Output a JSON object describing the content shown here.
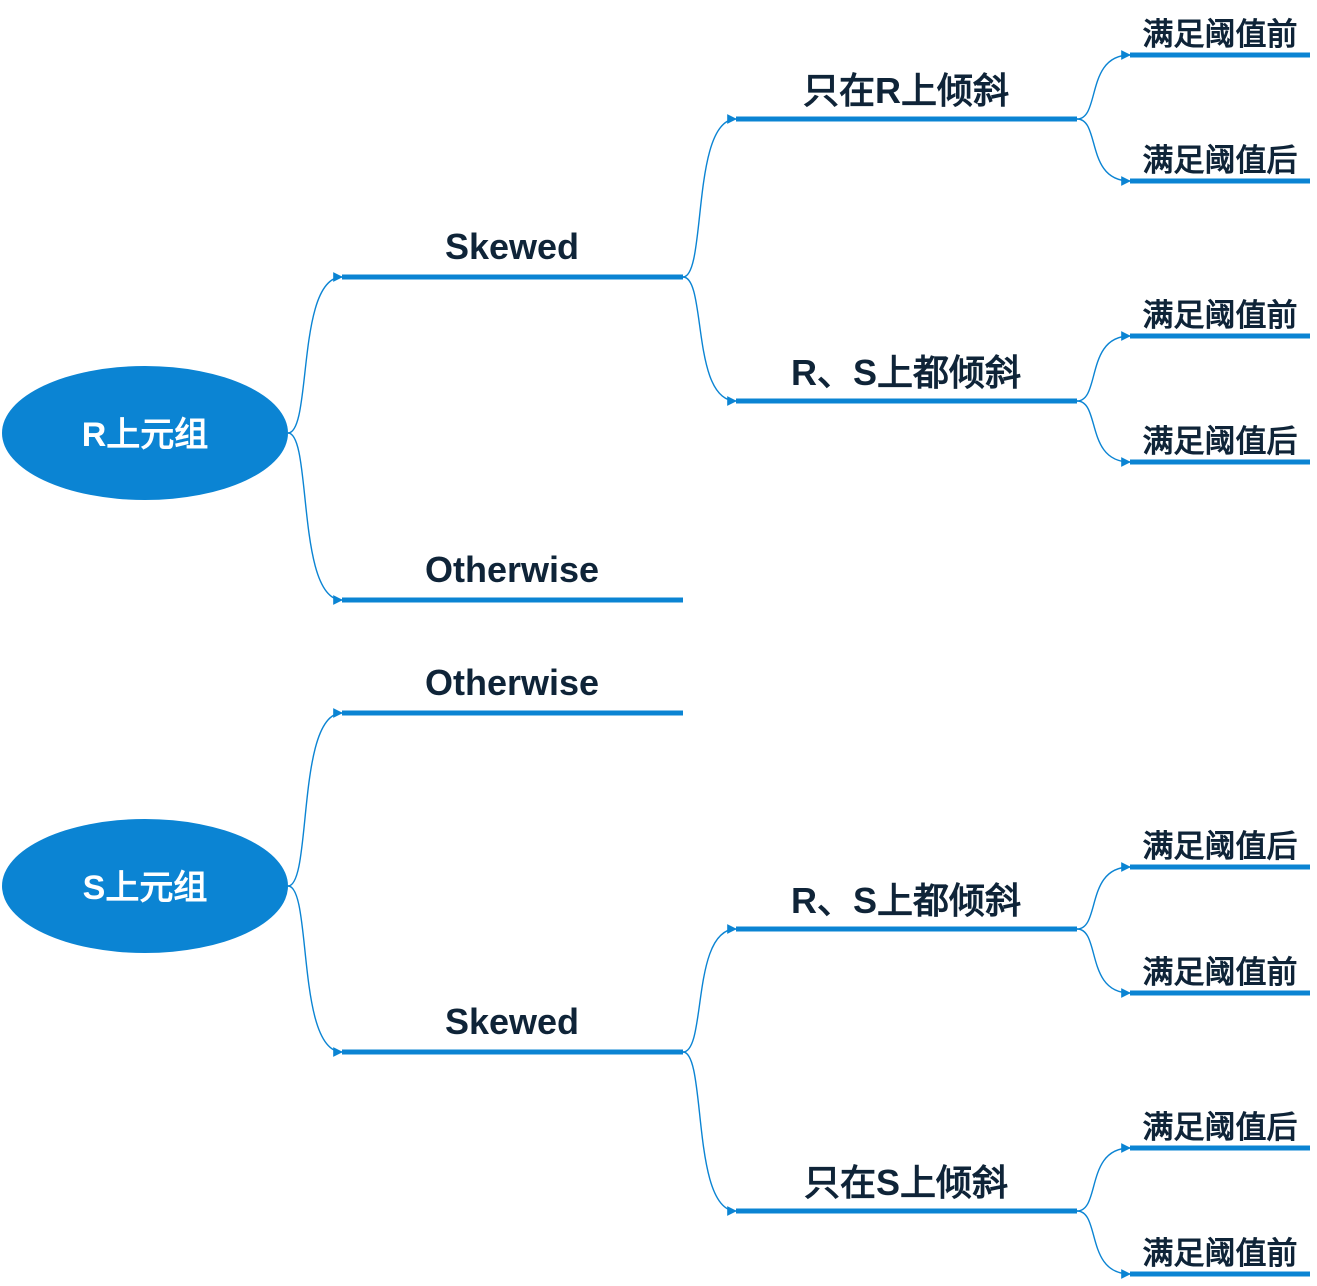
{
  "colors": {
    "accent": "#0b84d3",
    "text": "#0f2438",
    "root_text": "#ffffff"
  },
  "trees": [
    {
      "root": "R上元组",
      "branches": [
        {
          "label": "Skewed",
          "children": [
            {
              "label": "只在R上倾斜",
              "leaves": [
                "满足阈值前",
                "满足阈值后"
              ]
            },
            {
              "label": "R、S上都倾斜",
              "leaves": [
                "满足阈值前",
                "满足阈值后"
              ]
            }
          ]
        },
        {
          "label": "Otherwise"
        }
      ]
    },
    {
      "root": "S上元组",
      "branches": [
        {
          "label": "Otherwise"
        },
        {
          "label": "Skewed",
          "children": [
            {
              "label": "R、S上都倾斜",
              "leaves": [
                "满足阈值后",
                "满足阈值前"
              ]
            },
            {
              "label": "只在S上倾斜",
              "leaves": [
                "满足阈值后",
                "满足阈值前"
              ]
            }
          ]
        }
      ]
    }
  ]
}
